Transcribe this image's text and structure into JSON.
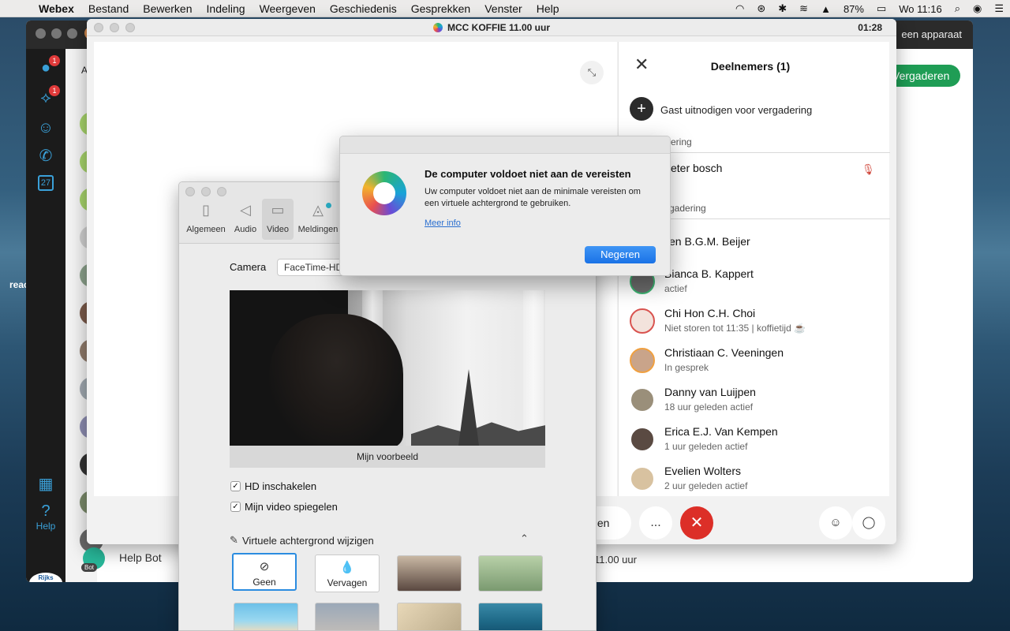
{
  "menubar": {
    "app": "Webex",
    "items": [
      "Bestand",
      "Bewerken",
      "Indeling",
      "Weergeven",
      "Geschiedenis",
      "Gesprekken",
      "Venster",
      "Help"
    ],
    "battery": "87%",
    "clock": "Wo 11:16"
  },
  "main_window": {
    "right_title": "een apparaat",
    "sidebar_badge_1": "1",
    "sidebar_badge_2": "1",
    "calendar_day": "27",
    "help_label": "Help",
    "logo_text": "Rijks Video",
    "tab_letter": "A",
    "join_button": "Vergaderen",
    "help_bot": "Help Bot",
    "bot_tag": "Bot",
    "meeting_time_suffix": "11.00 uur",
    "desktop_text": "reac"
  },
  "meeting": {
    "title": "MCC KOFFIE 11.00 uur",
    "timer": "01:28",
    "share_button_fragment": "elen",
    "more_label": "...",
    "end_label": "✕"
  },
  "participants": {
    "title": "Deelnemers (1)",
    "invite_label": "Gast uitnodigen voor vergadering",
    "section_in_meeting": "ering",
    "host_name": "eter bosch",
    "section_not_in_meeting": "rgadering",
    "people": [
      {
        "name": "en B.G.M. Beijer",
        "status": ""
      },
      {
        "name": "Bianca B. Kappert",
        "status": "actief"
      },
      {
        "name": "Chi Hon C.H. Choi",
        "status": "Niet storen tot 11:35 | koffietijd ☕"
      },
      {
        "name": "Christiaan C. Veeningen",
        "status": "In gesprek"
      },
      {
        "name": "Danny van Luijpen",
        "status": "18 uur geleden actief"
      },
      {
        "name": "Erica E.J. Van Kempen",
        "status": "1 uur geleden actief"
      },
      {
        "name": "Evelien Wolters",
        "status": "2 uur geleden actief"
      }
    ]
  },
  "dialog": {
    "title": "De computer voldoet niet aan de vereisten",
    "body": "Uw computer voldoet niet aan de minimale vereisten om een virtuele achtergrond te gebruiken.",
    "link": "Meer info",
    "button": "Negeren"
  },
  "prefs": {
    "tabs": [
      "Algemeen",
      "Audio",
      "Video",
      "Meldingen"
    ],
    "active_tab": "Video",
    "camera_label": "Camera",
    "camera_value": "FaceTime-HD",
    "preview_caption": "Mijn voorbeeld",
    "hd_label": "HD inschakelen",
    "mirror_label": "Mijn video spiegelen",
    "vbg_title": "Virtuele achtergrond wijzigen",
    "bg_none": "Geen",
    "bg_blur": "Vervagen"
  }
}
